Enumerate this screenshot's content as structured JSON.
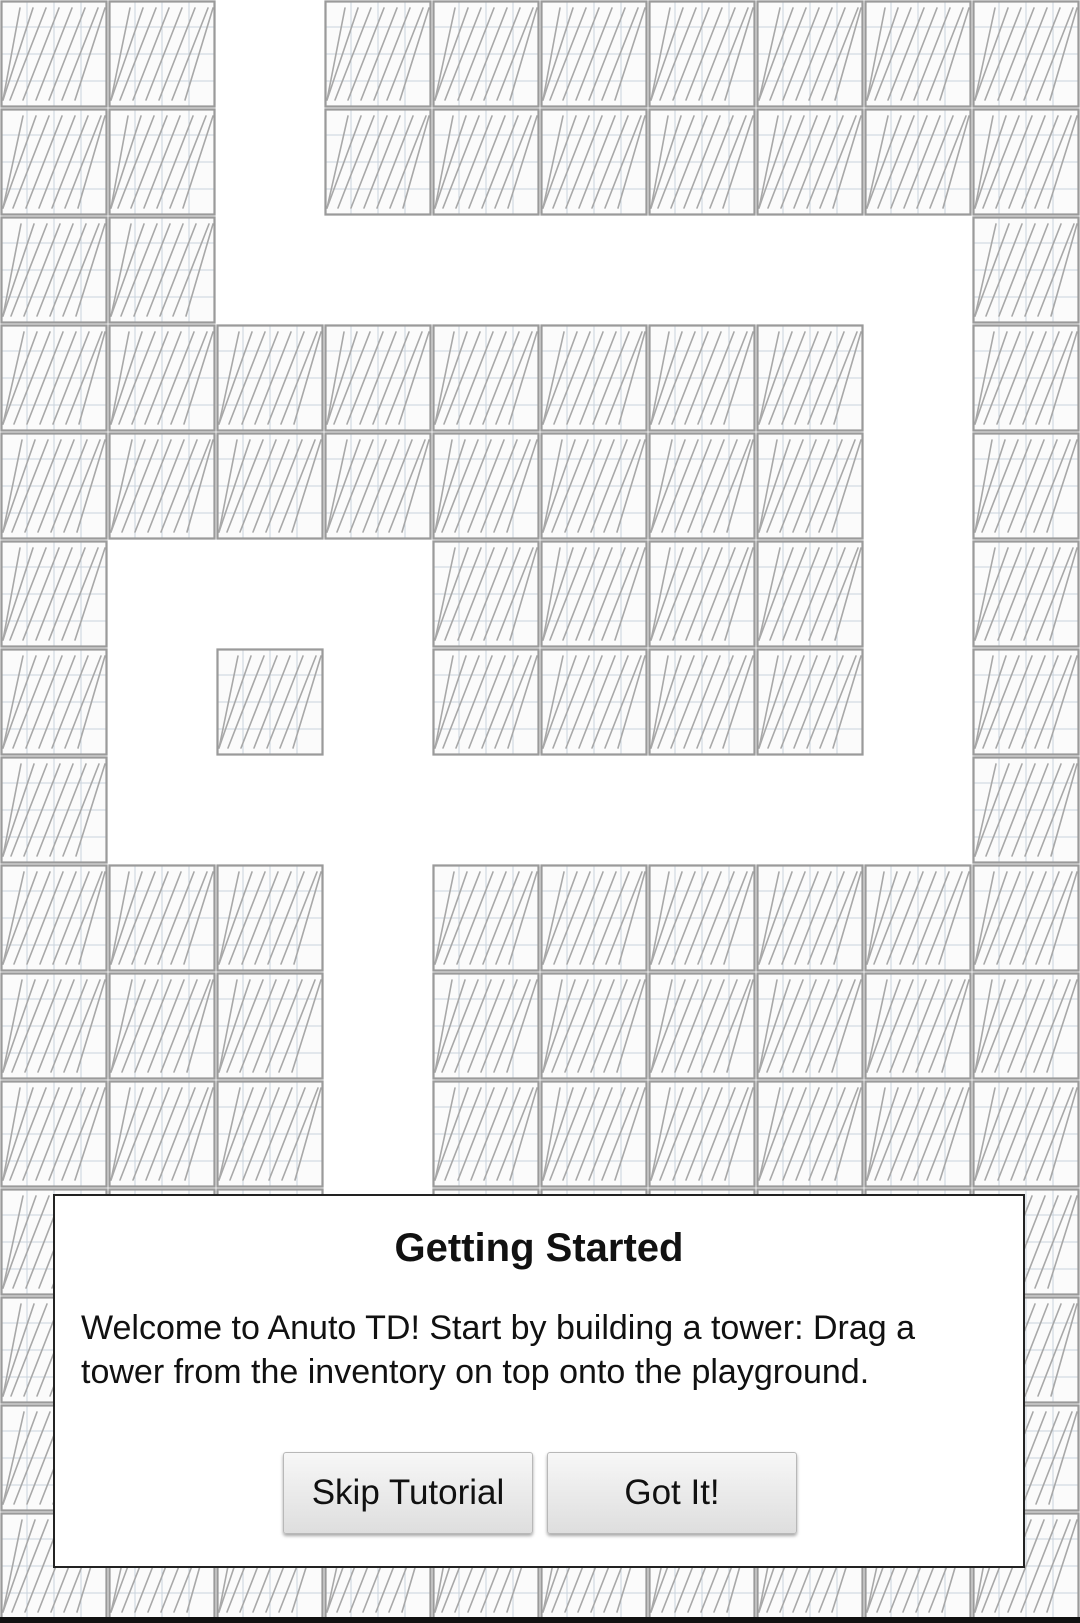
{
  "map": {
    "grid_columns": 10,
    "grid_rows": 15,
    "path_cells": [
      [
        2,
        0
      ],
      [
        2,
        1
      ],
      [
        2,
        2
      ],
      [
        3,
        2
      ],
      [
        4,
        2
      ],
      [
        5,
        2
      ],
      [
        6,
        2
      ],
      [
        7,
        2
      ],
      [
        8,
        2
      ],
      [
        8,
        3
      ],
      [
        8,
        4
      ],
      [
        8,
        5
      ],
      [
        8,
        6
      ],
      [
        1,
        5
      ],
      [
        2,
        5
      ],
      [
        3,
        5
      ],
      [
        1,
        6
      ],
      [
        3,
        6
      ],
      [
        1,
        7
      ],
      [
        2,
        7
      ],
      [
        3,
        7
      ],
      [
        4,
        7
      ],
      [
        5,
        7
      ],
      [
        6,
        7
      ],
      [
        7,
        7
      ],
      [
        8,
        7
      ],
      [
        3,
        8
      ],
      [
        3,
        9
      ],
      [
        3,
        10
      ],
      [
        3,
        11
      ]
    ],
    "colors": {
      "path": "#ffffff",
      "tile_fill": "#fbfbfb",
      "tile_border": "#9a9a9a",
      "hatch": "#a8a8a8",
      "grid_line": "#c9d3dc"
    }
  },
  "dialog": {
    "title": "Getting Started",
    "message": "Welcome to Anuto TD! Start by building a tower: Drag a tower from the inventory on top onto the playground.",
    "skip_label": "Skip Tutorial",
    "confirm_label": "Got It!"
  }
}
